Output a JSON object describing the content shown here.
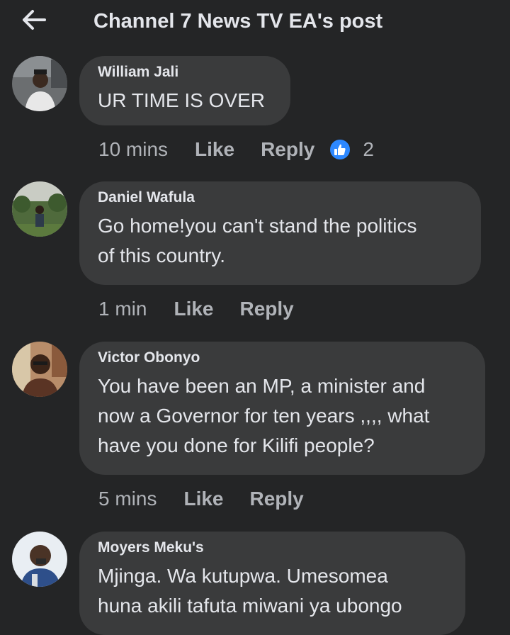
{
  "header": {
    "back_icon": "arrow-left-icon",
    "title": "Channel 7 News TV EA's post"
  },
  "comments": [
    {
      "author": "William Jali",
      "text": "UR TIME IS OVER",
      "time": "10 mins",
      "like_label": "Like",
      "reply_label": "Reply",
      "reaction_icon": "thumbs-up-icon",
      "reaction_count": "2"
    },
    {
      "author": "Daniel Wafula",
      "text": "Go home!you can't stand the politics\nof this country.",
      "time": "1 min",
      "like_label": "Like",
      "reply_label": "Reply"
    },
    {
      "author": "Victor Obonyo",
      "text": "You have been an MP, a minister and\nnow a Governor for ten years ,,,, what\nhave you done for Kilifi people?",
      "time": "5 mins",
      "like_label": "Like",
      "reply_label": "Reply"
    },
    {
      "author": "Moyers Meku's",
      "text": "Mjinga. Wa kutupwa. Umesomea\nhuna akili tafuta miwani ya ubongo"
    }
  ],
  "colors": {
    "background": "#242526",
    "bubble": "#3a3b3c",
    "primary_text": "#e4e6eb",
    "secondary_text": "#b0b3b8",
    "like_blue": "#2d88ff"
  }
}
